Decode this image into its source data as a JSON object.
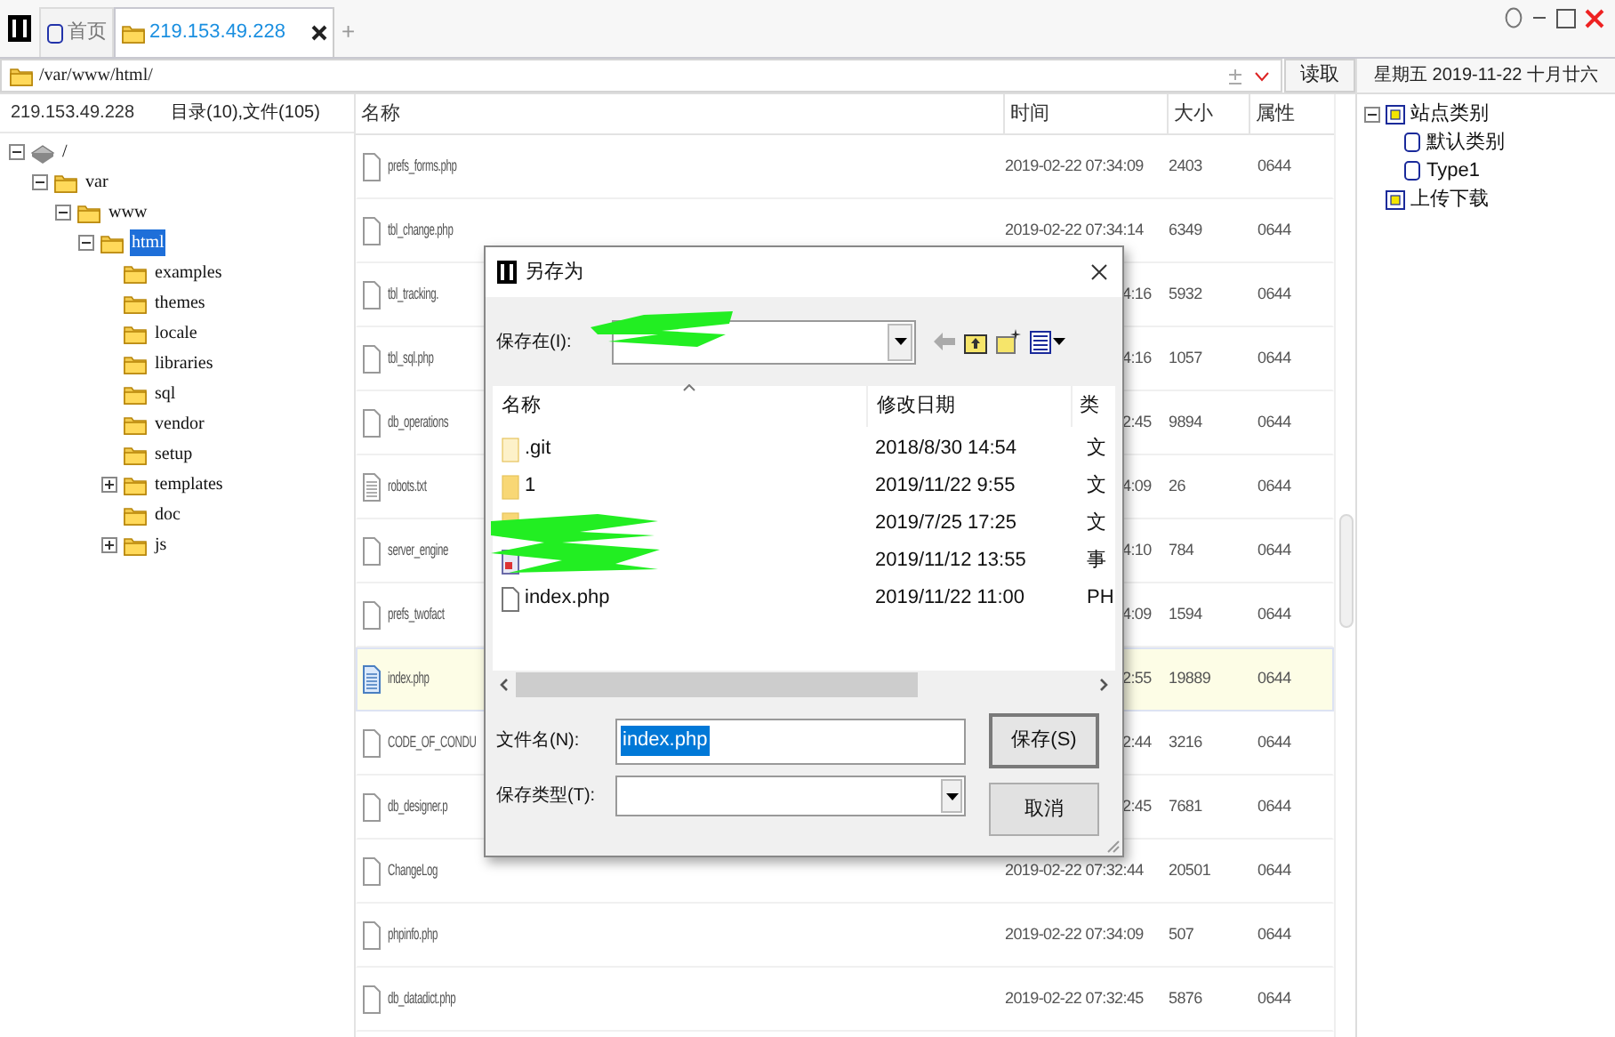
{
  "tabs": [
    {
      "label": "首页",
      "kind": "home",
      "selected": false,
      "closable": false
    },
    {
      "label": "219.153.49.228",
      "kind": "folder",
      "selected": true,
      "closable": true
    }
  ],
  "new_tab": "+",
  "address": {
    "value": "/var/www/html/",
    "button": "读取"
  },
  "date": "星期五 2019-11-22 十月廿六",
  "left_header": {
    "host": "219.153.49.228",
    "counts": "目录(10),文件(105)"
  },
  "tree": [
    {
      "label": "/",
      "kind": "drive",
      "expanded": true,
      "selected": false,
      "children": [
        {
          "label": "var",
          "kind": "folder",
          "expanded": true,
          "selected": false,
          "children": [
            {
              "label": "www",
              "kind": "folder",
              "expanded": true,
              "selected": false,
              "children": [
                {
                  "label": "html",
                  "kind": "folder",
                  "expanded": true,
                  "selected": true,
                  "children": [
                    {
                      "label": "examples",
                      "kind": "folder",
                      "selected": false
                    },
                    {
                      "label": "themes",
                      "kind": "folder",
                      "selected": false
                    },
                    {
                      "label": "locale",
                      "kind": "folder",
                      "selected": false
                    },
                    {
                      "label": "libraries",
                      "kind": "folder",
                      "selected": false
                    },
                    {
                      "label": "sql",
                      "kind": "folder",
                      "selected": false
                    },
                    {
                      "label": "vendor",
                      "kind": "folder",
                      "selected": false
                    },
                    {
                      "label": "setup",
                      "kind": "folder",
                      "selected": false
                    },
                    {
                      "label": "templates",
                      "kind": "folder",
                      "expanded": false,
                      "selected": false
                    },
                    {
                      "label": "doc",
                      "kind": "folder",
                      "selected": false
                    },
                    {
                      "label": "js",
                      "kind": "folder",
                      "expanded": false,
                      "selected": false
                    }
                  ]
                }
              ]
            }
          ]
        }
      ]
    }
  ],
  "table": {
    "columns": [
      "名称",
      "时间",
      "大小",
      "属性"
    ],
    "rows": [
      {
        "name": "prefs_forms.php",
        "kind": "file",
        "time": "2019-02-22 07:34:09",
        "size": "2403",
        "attr": "0644",
        "covered": false,
        "selected": false
      },
      {
        "name": "tbl_change.php",
        "kind": "file",
        "time": "2019-02-22 07:34:14",
        "size": "6349",
        "attr": "0644",
        "covered": false,
        "selected": false
      },
      {
        "name": "tbl_tracking.",
        "kind": "file",
        "time": "4:16",
        "size": "5932",
        "attr": "0644",
        "covered": true,
        "selected": false
      },
      {
        "name": "tbl_sql.php",
        "kind": "file",
        "time": "4:16",
        "size": "1057",
        "attr": "0644",
        "covered": true,
        "selected": false
      },
      {
        "name": "db_operations",
        "kind": "file",
        "time": "2:45",
        "size": "9894",
        "attr": "0644",
        "covered": true,
        "selected": false
      },
      {
        "name": "robots.txt",
        "kind": "text",
        "time": "4:09",
        "size": "26",
        "attr": "0644",
        "covered": true,
        "selected": false
      },
      {
        "name": "server_engine",
        "kind": "file",
        "time": "4:10",
        "size": "784",
        "attr": "0644",
        "covered": true,
        "selected": false
      },
      {
        "name": "prefs_twofact",
        "kind": "file",
        "time": "4:09",
        "size": "1594",
        "attr": "0644",
        "covered": true,
        "selected": false
      },
      {
        "name": "index.php",
        "kind": "text",
        "time": "2:55",
        "size": "19889",
        "attr": "0644",
        "covered": true,
        "selected": true
      },
      {
        "name": "CODE_OF_CONDU",
        "kind": "file",
        "time": "2:44",
        "size": "3216",
        "attr": "0644",
        "covered": true,
        "selected": false
      },
      {
        "name": "db_designer.p",
        "kind": "file",
        "time": "2:45",
        "size": "7681",
        "attr": "0644",
        "covered": true,
        "selected": false
      },
      {
        "name": "ChangeLog",
        "kind": "file",
        "time": "2019-02-22 07:32:44",
        "size": "20501",
        "attr": "0644",
        "covered": false,
        "selected": false
      },
      {
        "name": "phpinfo.php",
        "kind": "file",
        "time": "2019-02-22 07:34:09",
        "size": "507",
        "attr": "0644",
        "covered": false,
        "selected": false
      },
      {
        "name": "db_datadict.php",
        "kind": "file",
        "time": "2019-02-22 07:32:45",
        "size": "5876",
        "attr": "0644",
        "covered": false,
        "selected": false
      }
    ]
  },
  "sites": [
    {
      "label": "站点类别",
      "kind": "group",
      "expanded": true,
      "children": [
        {
          "label": "默认类别",
          "kind": "item"
        },
        {
          "label": "Type1",
          "kind": "item"
        }
      ]
    },
    {
      "label": "上传下载",
      "kind": "group"
    }
  ],
  "dialog": {
    "title": "另存为",
    "save_in_label": "保存在(I):",
    "columns": [
      "名称",
      "修改日期",
      "类"
    ],
    "rows": [
      {
        "name": ".git",
        "kind": "folder-light",
        "date": "2018/8/30 14:54",
        "type": "文"
      },
      {
        "name": "1",
        "kind": "folder",
        "date": "2019/11/22 9:55",
        "type": "文"
      },
      {
        "kind": "folder",
        "date": "2019/7/25 17:25",
        "type": "文"
      },
      {
        "kind": "app",
        "date": "2019/11/12 13:55",
        "type": "事"
      },
      {
        "name": "index.php",
        "kind": "file",
        "date": "2019/11/22 11:00",
        "type": "PH"
      }
    ],
    "file_name_label": "文件名(N):",
    "file_name": "index.php",
    "file_name_selected": true,
    "type_label": "保存类型(T):",
    "save": "保存(S)",
    "cancel": "取消"
  }
}
